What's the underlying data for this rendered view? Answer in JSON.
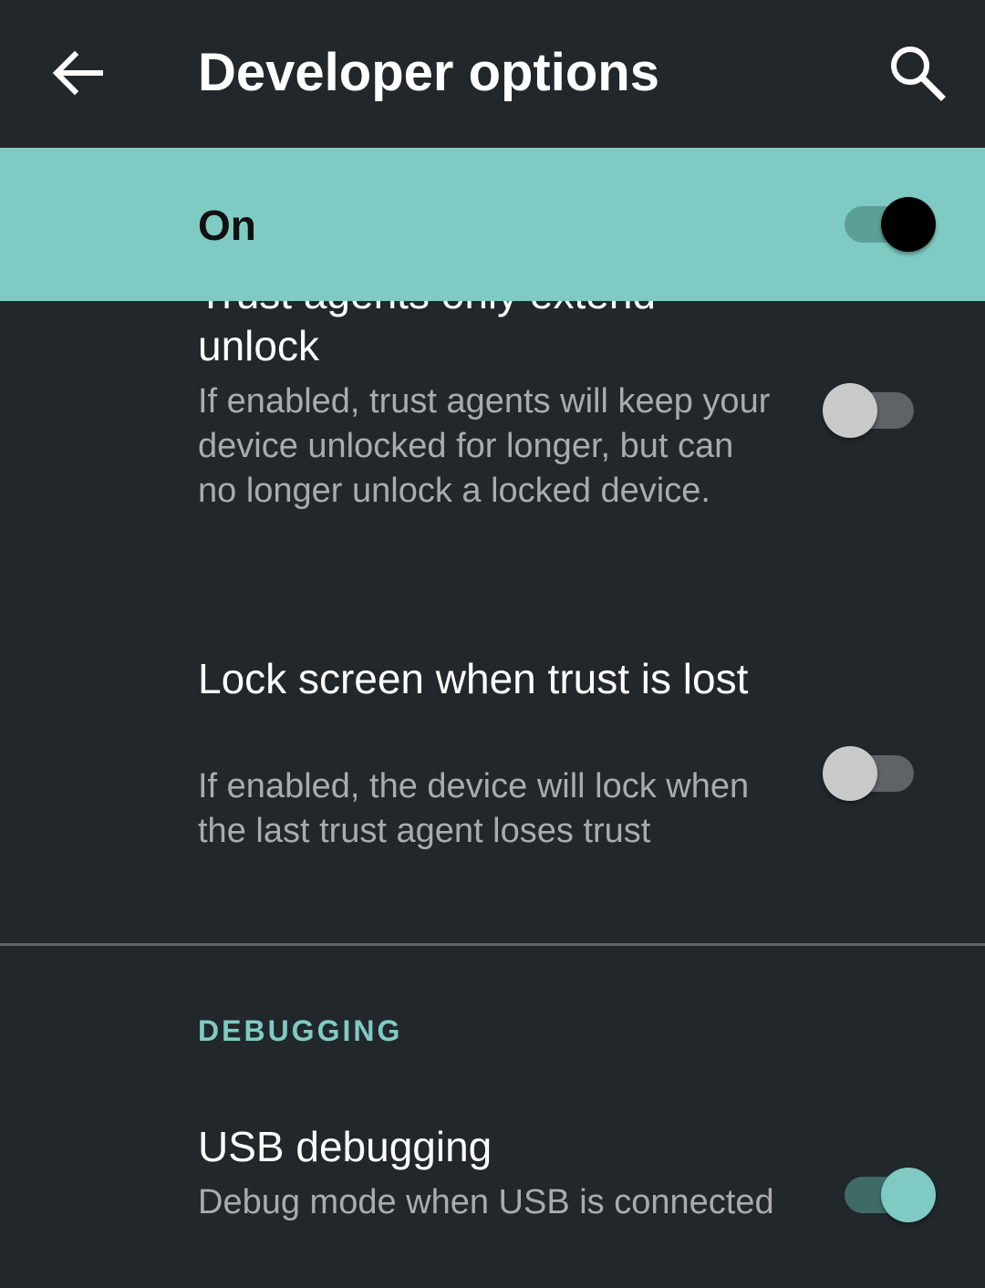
{
  "appbar": {
    "title": "Developer options",
    "back_icon": "arrow-left-icon",
    "search_icon": "search-icon"
  },
  "master_switch": {
    "label": "On",
    "state": "on"
  },
  "preferences": [
    {
      "title": "Trust agents only extend unlock",
      "summary": "If enabled, trust agents will keep your device unlocked for longer, but can no longer unlock a locked device.",
      "enabled": false
    },
    {
      "title": "Lock screen when trust is lost",
      "summary": "If enabled, the device will lock when the last trust agent loses trust",
      "enabled": false
    }
  ],
  "debugging": {
    "header": "DEBUGGING",
    "items": [
      {
        "title": "USB debugging",
        "summary": "Debug mode when USB is connected",
        "enabled": true
      }
    ]
  },
  "colors": {
    "background": "#22272c",
    "accent": "#7fcbc3",
    "summary_text": "#a9acaf"
  }
}
